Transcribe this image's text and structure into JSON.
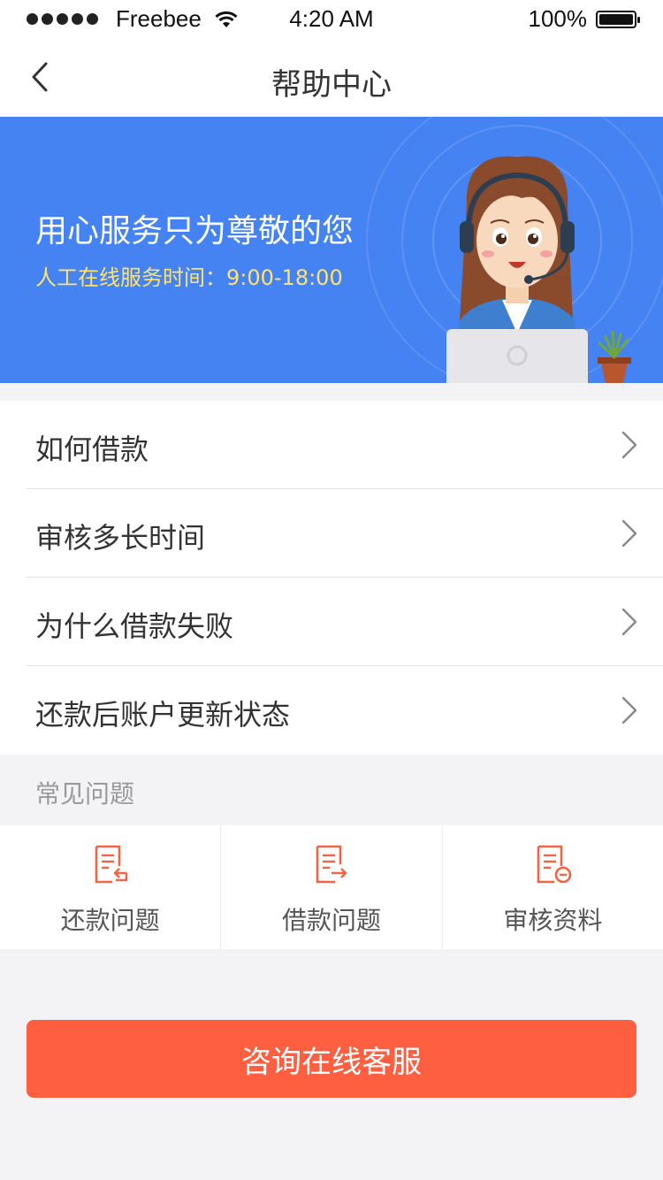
{
  "status_bar": {
    "carrier": "Freebee",
    "time": "4:20 AM",
    "battery": "100%",
    "battery_level": 1.0,
    "signal_icon": "signal-dots-icon",
    "wifi_icon": "wifi-icon",
    "battery_icon": "battery-icon"
  },
  "nav": {
    "title": "帮助中心",
    "back_icon": "chevron-left-icon"
  },
  "banner": {
    "title": "用心服务只为尊敬的您",
    "hours": "人工在线服务时间：9:00-18:00",
    "illustration": "customer-service-agent-illustration",
    "bg_color": "#4582f2",
    "hours_color": "#ffe36a"
  },
  "menu": {
    "items": [
      {
        "label": "如何借款"
      },
      {
        "label": "审核多长时间"
      },
      {
        "label": "为什么借款失败"
      },
      {
        "label": "还款后账户更新状态"
      }
    ],
    "chevron_icon": "chevron-right-icon"
  },
  "faq": {
    "header": "常见问题",
    "categories": [
      {
        "label": "还款问题",
        "icon": "document-return-icon"
      },
      {
        "label": "借款问题",
        "icon": "document-forward-icon"
      },
      {
        "label": "审核资料",
        "icon": "document-review-icon"
      }
    ],
    "icon_color": "#f06644"
  },
  "consult_button": {
    "label": "咨询在线客服",
    "color": "#fe5f40"
  }
}
